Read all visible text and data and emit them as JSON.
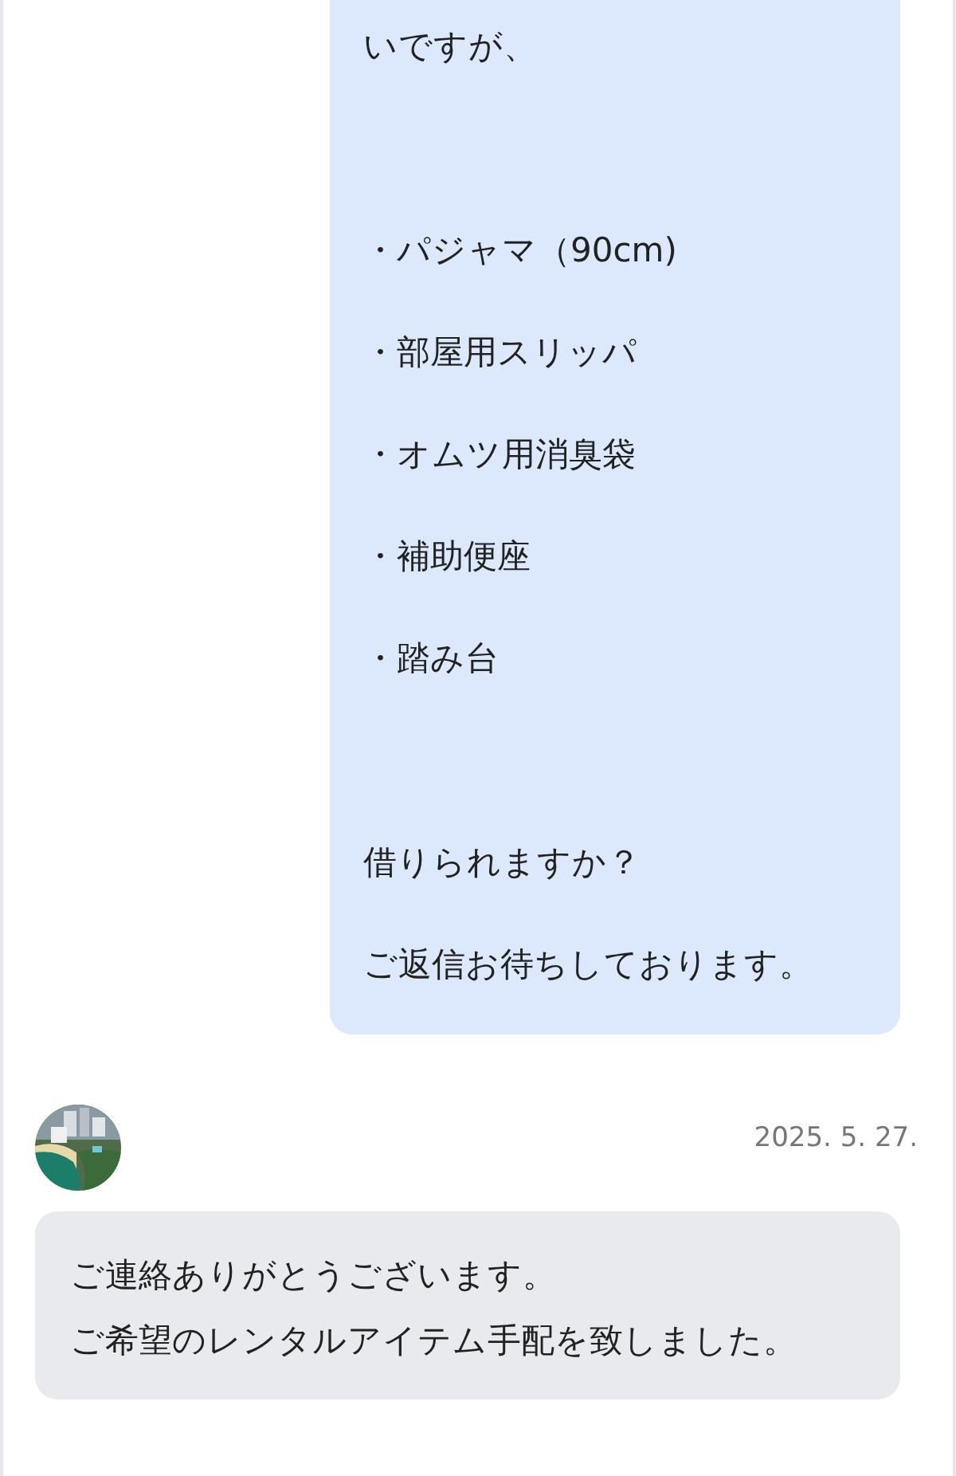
{
  "messages": [
    {
      "kind": "outgoing",
      "paragraphs": [
        [
          "いですが、"
        ],
        [
          "・パジャマ（90cm)",
          "・部屋用スリッパ",
          "・オムツ用消臭袋",
          "・補助便座",
          "・踏み台"
        ],
        [
          "借りられますか？",
          "ご返信お待ちしております。"
        ]
      ]
    },
    {
      "kind": "incoming",
      "date": "2025. 5. 27.",
      "avatar": {
        "kind": "picture"
      },
      "lines": [
        "ご連絡ありがとうございます。",
        "ご希望のレンタルアイテム手配を致しました。"
      ]
    }
  ]
}
